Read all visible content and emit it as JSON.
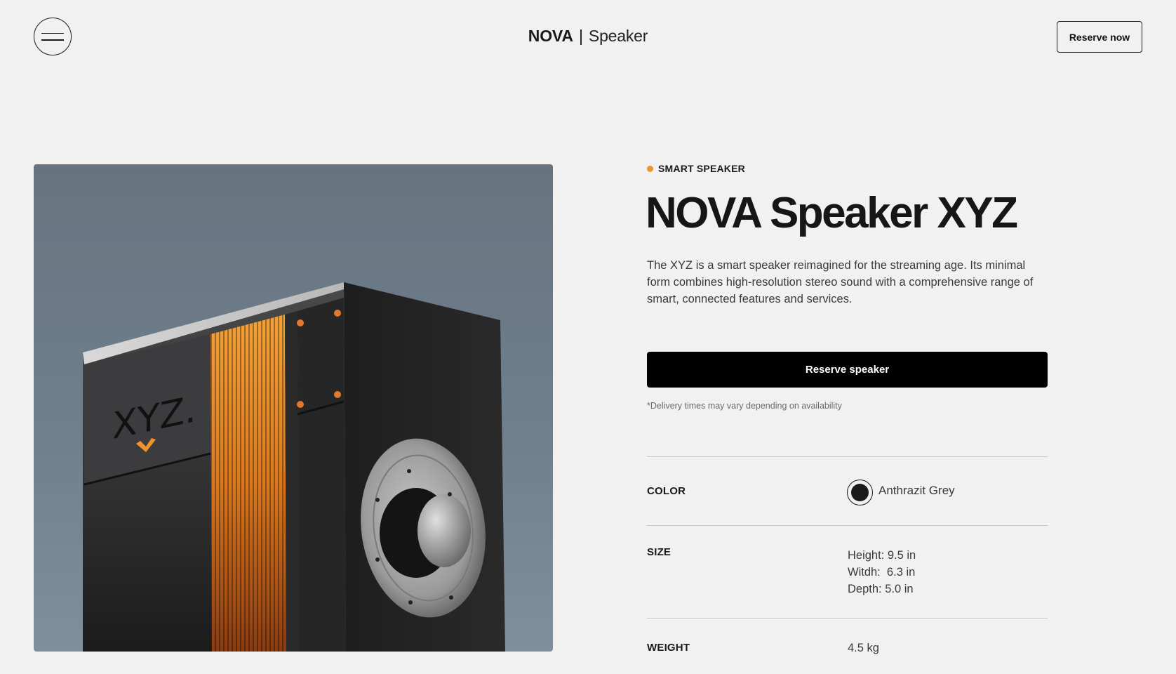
{
  "header": {
    "brand_bold": "NOVA",
    "brand_sep": "|",
    "brand_sub": "Speaker",
    "reserve_label": "Reserve now"
  },
  "product": {
    "category": "SMART SPEAKER",
    "title": "NOVA Speaker XYZ",
    "description": "The XYZ is a smart speaker reimagined for the streaming age. Its minimal form combines high-resolution stereo sound with a comprehensive range of smart, connected features and services.",
    "reserve_label": "Reserve speaker",
    "delivery_note": "*Delivery times may vary depending on availability",
    "image_logo_text": "XYZ."
  },
  "specs": {
    "color": {
      "label": "COLOR",
      "value": "Anthrazit Grey",
      "swatch_color": "#1b1b1b"
    },
    "size": {
      "label": "SIZE",
      "lines": [
        "Height: 9.5 in",
        "Witdh:  6.3 in",
        "Depth: 5.0 in"
      ]
    },
    "weight": {
      "label": "WEIGHT",
      "value": "4.5 kg"
    }
  },
  "colors": {
    "accent": "#f0932a",
    "primary_button": "#000000",
    "background": "#f1f1f1"
  }
}
